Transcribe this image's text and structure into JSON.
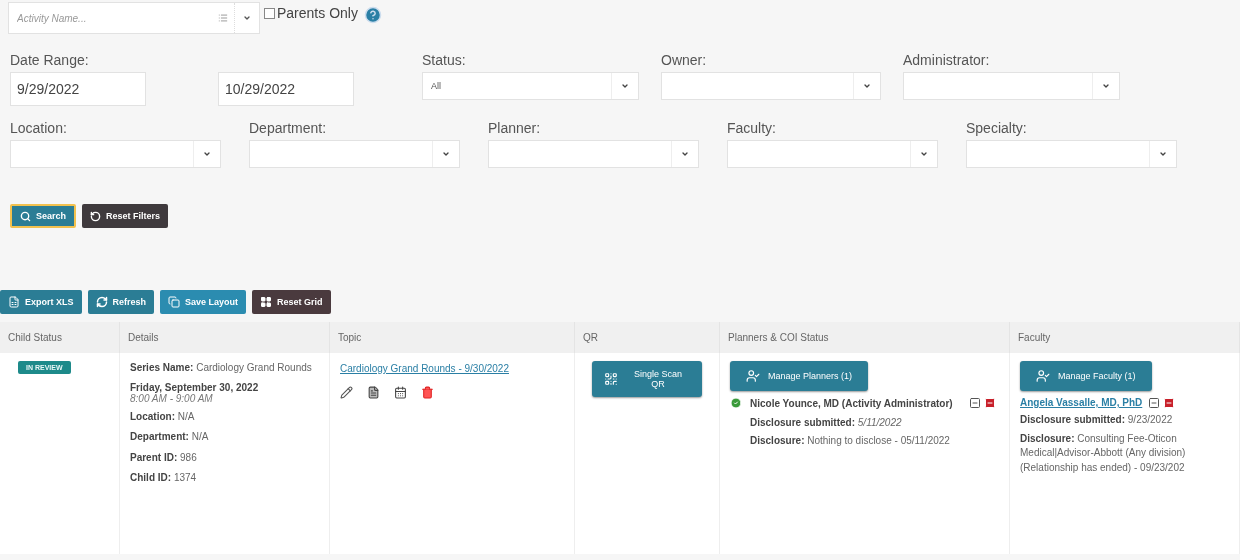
{
  "activity_search": {
    "placeholder": "Activity Name...",
    "parents_only": {
      "label": "Parents Only",
      "checked": false
    }
  },
  "filters": {
    "date_range": {
      "label": "Date Range:",
      "from": "9/29/2022",
      "to": "10/29/2022"
    },
    "row_1": [
      {
        "label": "Status:",
        "value": "All"
      },
      {
        "label": "Owner:"
      },
      {
        "label": "Administrator:"
      }
    ],
    "row_2": [
      {
        "label": "Location:"
      },
      {
        "label": "Department:"
      },
      {
        "label": "Planner:"
      },
      {
        "label": "Faculty:"
      },
      {
        "label": "Specialty:"
      }
    ]
  },
  "actions": [
    {
      "label": "Search",
      "kind": "search"
    },
    {
      "label": "Reset Filters",
      "kind": "reset"
    }
  ],
  "grid_toolbar": [
    {
      "label": "Export XLS",
      "kind": "export"
    },
    {
      "label": "Refresh",
      "kind": "refresh"
    },
    {
      "label": "Save Layout",
      "kind": "save"
    },
    {
      "label": "Reset Grid",
      "kind": "reset"
    }
  ],
  "table": {
    "columns": [
      "Child Status",
      "Details",
      "Topic",
      "QR",
      "Planners & COI Status",
      "Faculty"
    ],
    "rows": [
      {
        "status": "IN REVIEW",
        "details": [
          "**Series Name:** Cardiology Grand Rounds"
        ],
        "date": "Friday, September 30, 2022",
        "time": "8:00 AM - 9:00 AM",
        "details_more": [
          "**Location:** N/A",
          "**Department:** N/A",
          "**Parent ID:** 986",
          "**Child ID:** 1374"
        ],
        "topic": "Cardiology Grand Rounds - 9/30/2022",
        "qr_button": "Single Scan QR",
        "planners": {
          "button": "Manage Planners (1)",
          "people": [
            {
              "name": "Nicole Younce, MD (Activity Administrator)",
              "approved": true,
              "submitted": "**Disclosure submitted:** *5/11/2022*",
              "disclosure": "**Disclosure:** Nothing to disclose - 05/11/2022"
            }
          ]
        },
        "faculty": {
          "button": "Manage Faculty (1)",
          "people": [
            {
              "name": "Angela Vassalle, MD, PhD",
              "submitted": "**Disclosure submitted:** 9/23/2022",
              "disclosure": "**Disclosure:** Consulting Fee-Oticon Medical|Advisor-Abbott (Any division) (Relationship has ended) - 09/23/202"
            }
          ]
        }
      }
    ]
  }
}
